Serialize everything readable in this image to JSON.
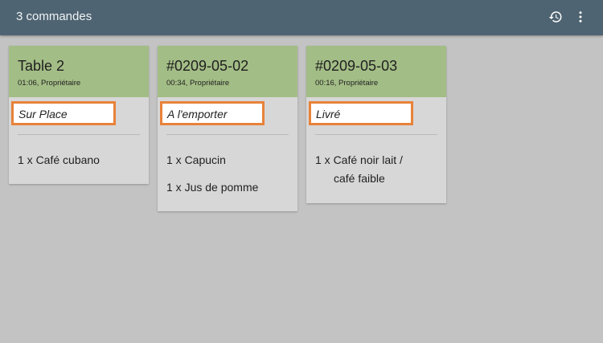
{
  "header": {
    "title": "3 commandes",
    "history_icon": "history-icon",
    "more_icon": "more-vert-icon"
  },
  "colors": {
    "appbar": "#4f6472",
    "background": "#c3c3c3",
    "card_header": "#a3bd86",
    "card_body": "#d7d7d7",
    "highlight_border": "#e8823a"
  },
  "orders": [
    {
      "title": "Table 2",
      "subtitle": "01:06, Propriétaire",
      "mode": "Sur Place",
      "items": [
        {
          "text": "1 x Café cubano"
        }
      ]
    },
    {
      "title": "#0209-05-02",
      "subtitle": "00:34, Propriétaire",
      "mode": "A l'emporter",
      "items": [
        {
          "text": "1 x Capucin"
        },
        {
          "text": "1 x Jus de pomme"
        }
      ]
    },
    {
      "title": "#0209-05-03",
      "subtitle": "00:16, Propriétaire",
      "mode": "Livré",
      "items": [
        {
          "line1": "1 x Café noir lait /",
          "line2": "café faible"
        }
      ]
    }
  ]
}
